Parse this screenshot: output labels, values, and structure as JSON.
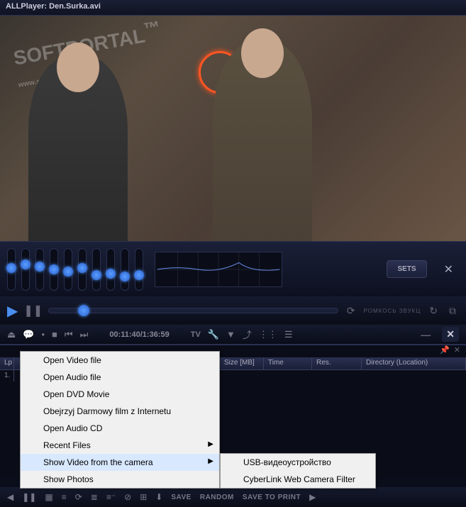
{
  "title": "ALLPlayer: Den.Surka.avi",
  "watermark": {
    "main": "SOFTPORTAL",
    "sub": "www.softportal.com",
    "tm": "™"
  },
  "eq": {
    "sets_label": "SETS",
    "slider_positions": [
      20,
      15,
      18,
      22,
      25,
      20,
      30,
      28,
      32,
      30
    ]
  },
  "seek": {
    "volume_label": "РОМКОСЬ ЗВУКЦ"
  },
  "toolbar": {
    "time": "00:11:40/1:36:59",
    "tv_label": "TV"
  },
  "columns": {
    "lp": "Lp",
    "name": "",
    "size": "Size [MB]",
    "time": "Time",
    "res": "Res.",
    "dir": "Directory (Location)"
  },
  "row": {
    "num": "1."
  },
  "bottom": {
    "save": "SAVE",
    "random": "RANDOM",
    "save_to_print": "SAVE TO PRINT"
  },
  "menu": {
    "items": [
      "Open Video file",
      "Open Audio file",
      "Open DVD Movie",
      "Obejrzyj Darmowy film z Internetu",
      "Open Audio CD",
      "Recent Files",
      "Show Video from the camera",
      "Show Photos"
    ],
    "submenu": [
      "USB-видеоустройство",
      "CyberLink Web Camera Filter"
    ]
  }
}
